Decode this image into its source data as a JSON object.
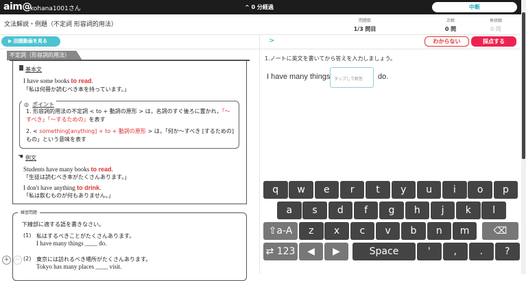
{
  "topbar": {
    "logo": "aim@",
    "user": "kohana1001さん",
    "timer": "^ 0 分経過",
    "pause": "中断"
  },
  "header": {
    "title": "文法解説・例題（不定詞 形容詞的用法）",
    "stats": [
      {
        "label": "問題数",
        "value": "1/3 問目"
      },
      {
        "label": "正解",
        "value": "0 問"
      },
      {
        "label": "再挑戦",
        "value": "0 問"
      }
    ]
  },
  "toolbar": {
    "video": "▶ 回題動画を見る",
    "next": ">",
    "dunno": "わからない",
    "grade": "採点する"
  },
  "lesson": {
    "tab": "不定詞（形容詞的用法）",
    "basic_heading": "基本文",
    "basic_en_pre": "I have some books ",
    "basic_en_red": "to read",
    "basic_en_post": ".",
    "basic_jp": "「私は何冊か読むべき本を持っています。」",
    "point_heading": "ポイント",
    "point1_a": "1. 形容詞的用法の不定詞 < to + 動詞の原形 > は，名詞のすぐ後ろに置かれ，",
    "point1_red": "「～すべき」「～するための」",
    "point1_b": "を表す",
    "point2_a": "2. < ",
    "point2_red": "something[anything] + to + 動詞の原形",
    "point2_b": " > は，「何か～すべき [するための] もの」という意味を表す",
    "example_heading": "例文",
    "ex1_en_pre": "Students have many books ",
    "ex1_en_red": "to read",
    "ex1_en_post": ".",
    "ex1_jp": "「生徒は読むべき本がたくさんあります。」",
    "ex2_en_pre": "I don't have anything ",
    "ex2_en_red": "to drink",
    "ex2_en_post": ".",
    "ex2_jp": "「私は飲むものが何もありません。」",
    "practice_heading": "練習問題",
    "practice_inst": "下線部に適する語を書きなさい。",
    "p1_num": "(1)",
    "p1_jp": "私はするべきことがたくさんあります。",
    "p1_en": "I have many things ____ do.",
    "p2_num": "(2)",
    "p2_jp": "東京には訪れるべき場所がたくさんあります。",
    "p2_en": "Tokyo has many places ____ visit.",
    "zoom_in": "+",
    "zoom_out": "−"
  },
  "question": {
    "instruction": "1.ノートに英文を書いてから答えを入力しましょう。",
    "pre": "I have many things",
    "placeholder": "タップして解答",
    "post": "do."
  },
  "keyboard": {
    "row1": [
      "q",
      "w",
      "e",
      "r",
      "t",
      "y",
      "u",
      "i",
      "o",
      "p"
    ],
    "row2": [
      "a",
      "s",
      "d",
      "f",
      "g",
      "h",
      "j",
      "k",
      "l"
    ],
    "row3": [
      "z",
      "x",
      "c",
      "v",
      "b",
      "n",
      "m"
    ],
    "shift": "⇧a-A",
    "backspace": "⌫",
    "symbols": "⇄ 123",
    "left": "◀",
    "right": "▶",
    "space": "Space",
    "row4": [
      "'",
      ",",
      ".",
      "?"
    ]
  }
}
